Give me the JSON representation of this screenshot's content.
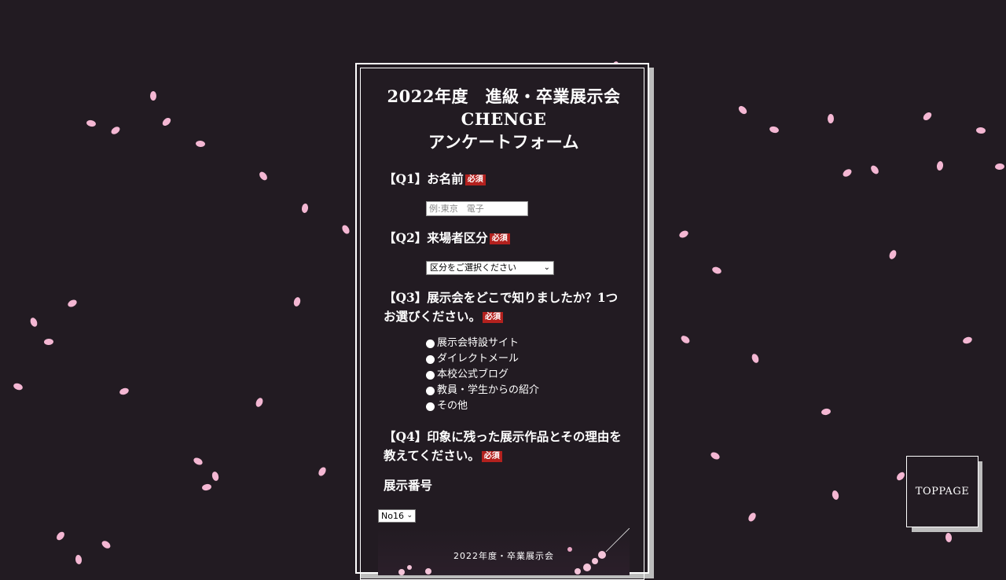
{
  "form": {
    "title_line1": "2022年度　進級・卒業展示会",
    "title_line2": "CHENGE",
    "title_line3": "アンケートフォーム",
    "required_label": "必須",
    "q1": {
      "label": "【Q1】お名前",
      "placeholder": "例:東京　電子"
    },
    "q2": {
      "label": "【Q2】来場者区分",
      "select_value": "区分をご選択ください"
    },
    "q3": {
      "label": "【Q3】展示会をどこで知りましたか？1つお選びください。",
      "options": [
        "展示会特設サイト",
        "ダイレクトメール",
        "本校公式ブログ",
        "教員・学生からの紹介",
        "その他"
      ]
    },
    "q4": {
      "label": "【Q4】印象に残った展示作品とその理由を教えてください。"
    },
    "exhibit_number": {
      "label": "展示番号",
      "select_value": "No16"
    },
    "preview_caption": "2022年度・卒業展示会"
  },
  "toppage": {
    "label": "TOPPAGE"
  },
  "colors": {
    "background": "#221b22",
    "required_badge": "#b3211e",
    "petal": "#f4b7d3"
  }
}
